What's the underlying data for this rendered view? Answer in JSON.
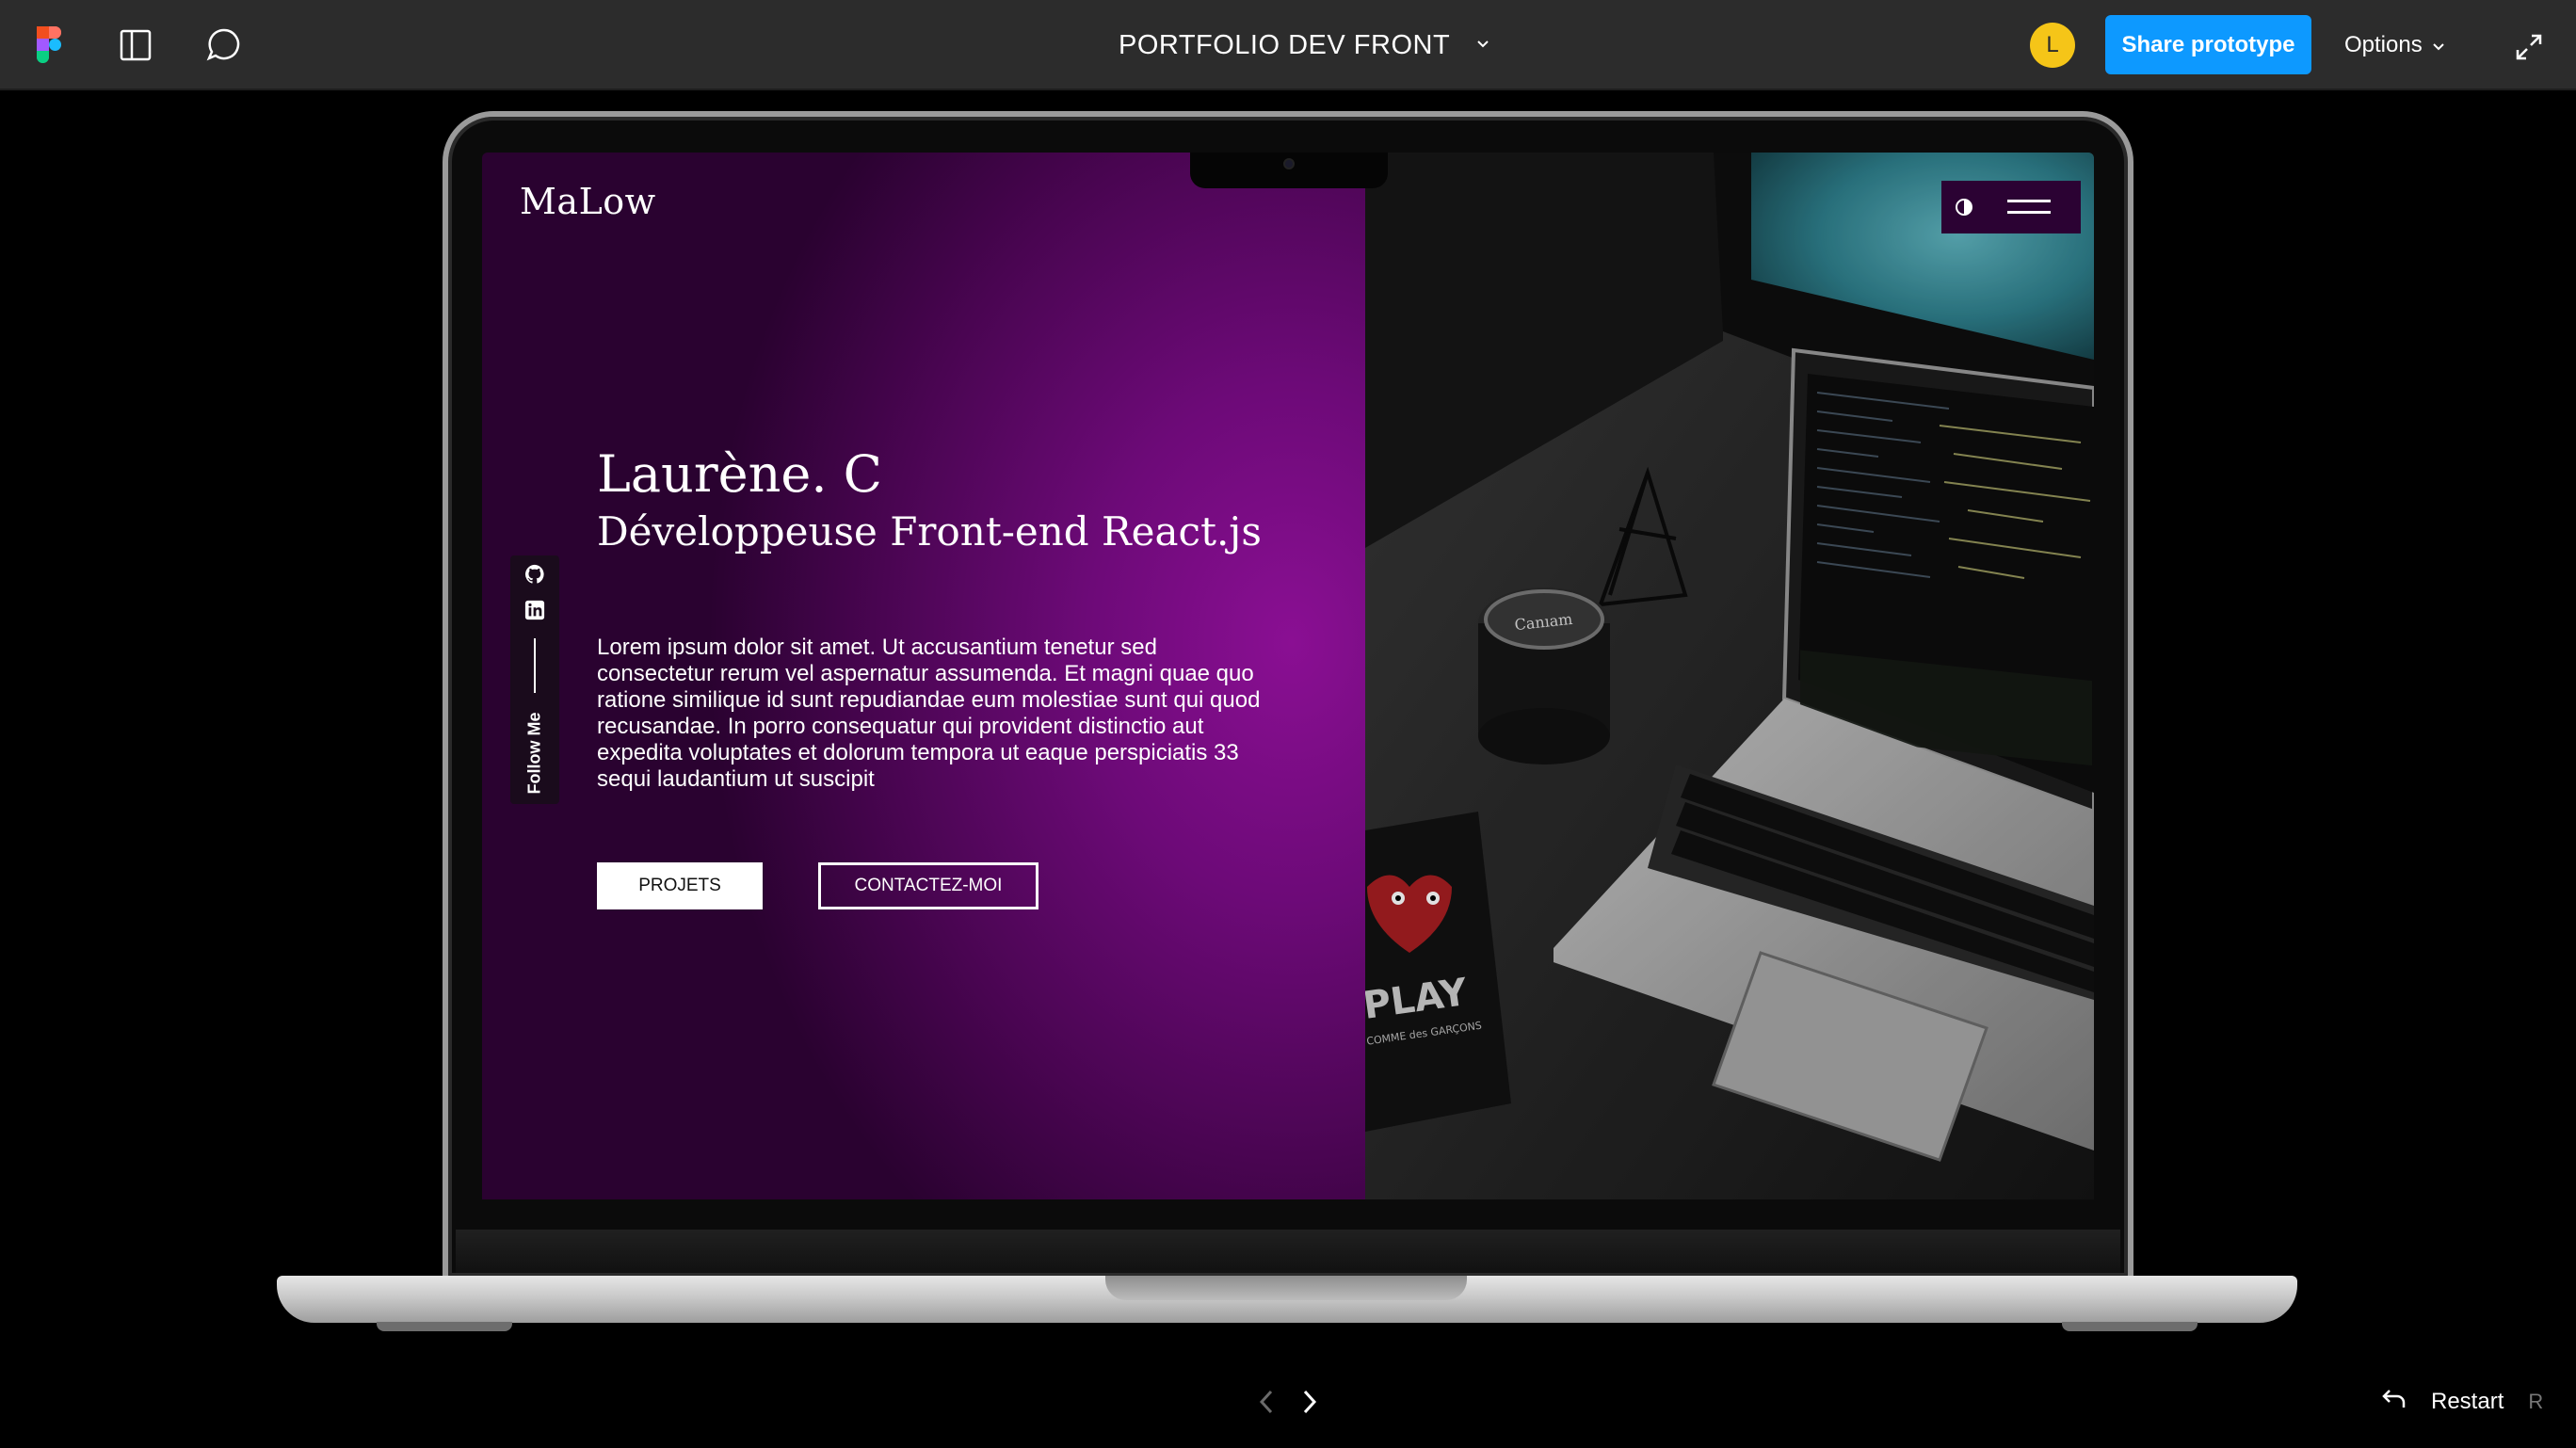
{
  "toolbar": {
    "file_title": "PORTFOLIO DEV FRONT",
    "avatar_initial": "L",
    "share_label": "Share prototype",
    "options_label": "Options"
  },
  "site": {
    "brand": "MaLow",
    "name": "Laurène. C",
    "role": "Développeuse Front-end React.js",
    "intro": "Lorem ipsum dolor sit amet. Ut accusantium tenetur sed consectetur rerum vel aspernatur assumenda. Et magni quae quo ratione similique id sunt repudiandae eum molestiae sunt qui quod recusandae. In porro consequatur qui provident distinctio aut expedita voluptates et dolorum tempora ut eaque perspiciatis 33 sequi laudantium ut suscipit",
    "btn_projects": "PROJETS",
    "btn_contact": "CONTACTEZ-MOI",
    "follow_label": "Follow Me",
    "photo": {
      "mug_text": "Canıam",
      "phone_text": "PLAY",
      "phone_subtext": "COMME des GARÇONS"
    }
  },
  "footer": {
    "restart_label": "Restart",
    "restart_key": "R"
  },
  "colors": {
    "toolbar_bg": "#2c2c2c",
    "accent_blue": "#0d99ff",
    "avatar_yellow": "#f5c518",
    "purple": "#6d0a78",
    "nav_purple": "#2b0233"
  },
  "icons": [
    "figma-logo-icon",
    "panel-icon",
    "comment-icon",
    "chevron-down-icon",
    "expand-icon",
    "github-icon",
    "linkedin-icon",
    "contrast-icon",
    "menu-icon",
    "chevron-left-icon",
    "chevron-right-icon",
    "restart-icon"
  ]
}
